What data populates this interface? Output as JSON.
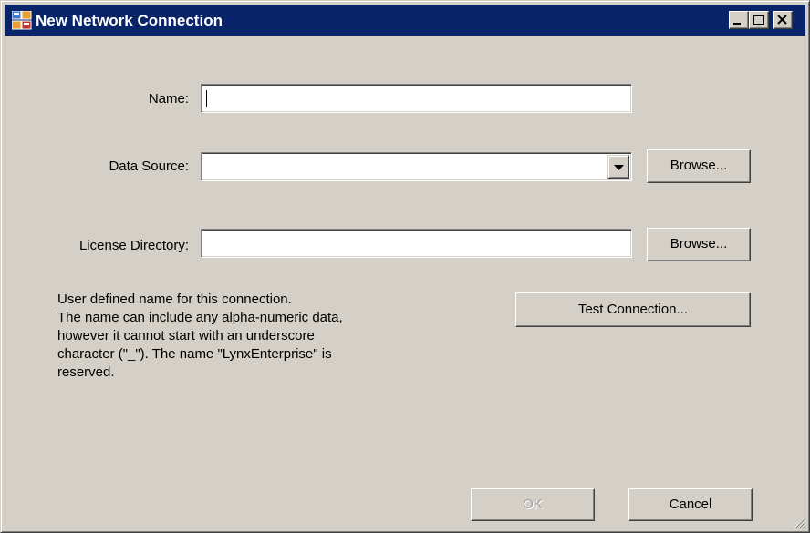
{
  "window": {
    "title": "New Network Connection",
    "icon": "network-connection-app-icon",
    "controls": {
      "minimize": "minimize-icon",
      "maximize": "maximize-icon",
      "close": "close-icon"
    }
  },
  "form": {
    "name": {
      "label": "Name:",
      "value": ""
    },
    "data_source": {
      "label": "Data Source:",
      "value": "",
      "browse_label": "Browse..."
    },
    "license_directory": {
      "label": "License Directory:",
      "value": "",
      "browse_label": "Browse..."
    },
    "test_connection_label": "Test Connection..."
  },
  "help": {
    "lines": [
      "User defined name for this connection.",
      "The name can include any alpha-numeric data,",
      "however it cannot start with an underscore",
      "character (\"_\").  The name \"LynxEnterprise\" is",
      "reserved."
    ]
  },
  "footer": {
    "ok_label": "OK",
    "ok_enabled": false,
    "cancel_label": "Cancel"
  },
  "colors": {
    "face": "#d4d0c8",
    "titlebar": "#0a246a",
    "disabled_text": "#a0a0a0"
  }
}
